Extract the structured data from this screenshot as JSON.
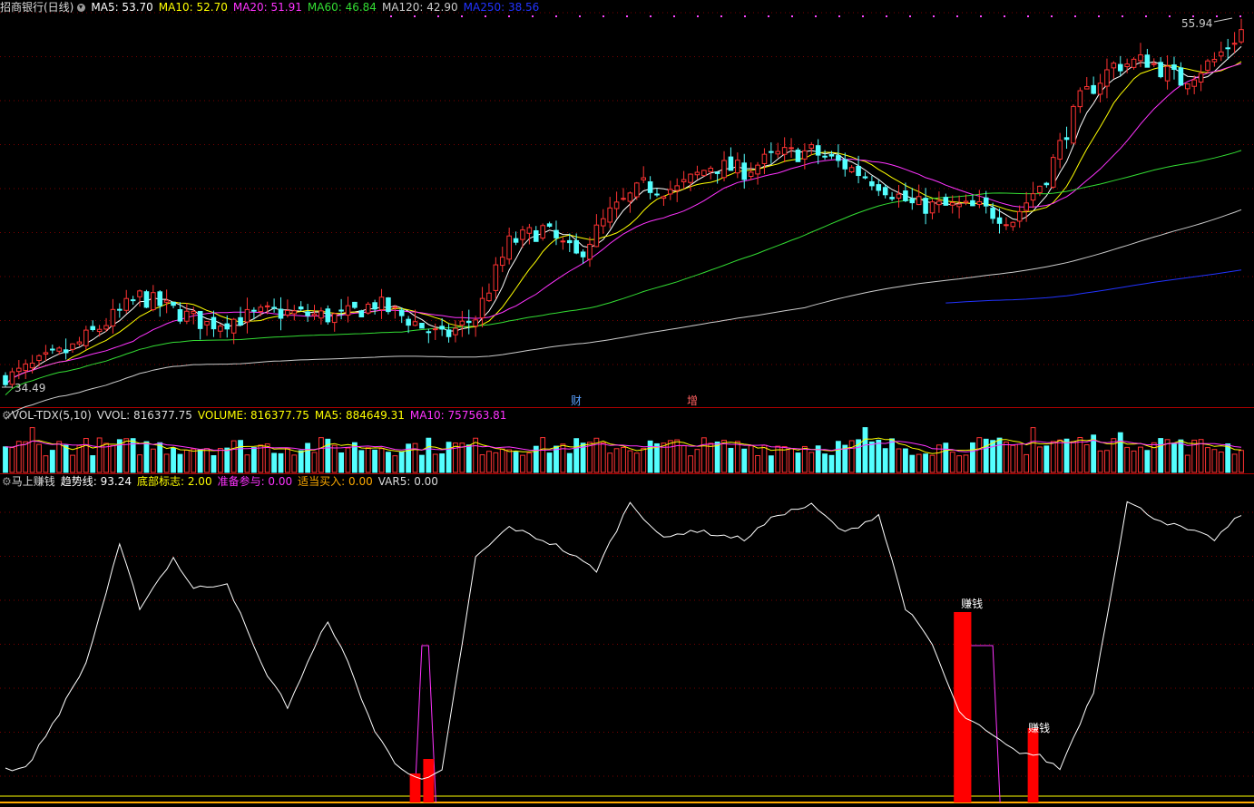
{
  "main_legend": {
    "title": "招商银行(日线)",
    "ma5": {
      "label": "MA5: 53.70",
      "color": "#ffffff"
    },
    "ma10": {
      "label": "MA10: 52.70",
      "color": "#ffff00"
    },
    "ma20": {
      "label": "MA20: 51.91",
      "color": "#ff33ff"
    },
    "ma60": {
      "label": "MA60: 46.84",
      "color": "#33dd33"
    },
    "ma120": {
      "label": "MA120: 42.90",
      "color": "#cccccc"
    },
    "ma250": {
      "label": "MA250: 38.56",
      "color": "#2233ff"
    }
  },
  "vol_legend": {
    "name": "VOL-TDX(5,10)",
    "vvol": "VVOL: 816377.75",
    "volume": "VOLUME: 816377.75",
    "ma5": "MA5: 884649.31",
    "ma10": "MA10: 757563.81"
  },
  "ind_legend": {
    "name": "马上赚钱",
    "trend": "趋势线: 93.24",
    "bottom": "底部标志: 2.00",
    "prepare": "准备参与: 0.00",
    "buy": "适当买入: 0.00",
    "var5": "VAR5: 0.00"
  },
  "annotations": {
    "high_label": "55.94",
    "low_label": "34.49",
    "cai": "财",
    "zeng": "增",
    "signal1": "赚钱",
    "signal2": "赚钱"
  },
  "colors": {
    "up": "#ff3333",
    "down": "#54ffff",
    "grid": "#7a0000",
    "divider": "#aa0000",
    "trend_line": "#ffffff",
    "prepare_line": "#ff33ff",
    "signal_bar": "#ff0000",
    "baseline": "#ffaa00"
  },
  "chart_data": [
    {
      "type": "candlestick",
      "title": "招商银行(日线)",
      "ylim": [
        34.49,
        55.94
      ],
      "key_prices": {
        "high": 55.94,
        "low": 34.49,
        "last_close_approx": 53.7
      },
      "trend_path": [
        [
          0,
          35.0
        ],
        [
          10,
          36.8
        ],
        [
          20,
          39.8
        ],
        [
          30,
          38.2
        ],
        [
          40,
          38.9
        ],
        [
          50,
          38.6
        ],
        [
          55,
          39.4
        ],
        [
          60,
          38.5
        ],
        [
          65,
          37.4
        ],
        [
          70,
          38.6
        ],
        [
          75,
          42.9
        ],
        [
          80,
          43.7
        ],
        [
          85,
          42.1
        ],
        [
          90,
          44.6
        ],
        [
          95,
          46.2
        ],
        [
          100,
          46.0
        ],
        [
          105,
          47.4
        ],
        [
          110,
          47.1
        ],
        [
          115,
          48.0
        ],
        [
          120,
          48.2
        ],
        [
          125,
          47.4
        ],
        [
          130,
          46.4
        ],
        [
          135,
          45.1
        ],
        [
          140,
          45.0
        ],
        [
          145,
          44.9
        ],
        [
          150,
          44.3
        ],
        [
          155,
          46.8
        ],
        [
          160,
          51.2
        ],
        [
          165,
          53.2
        ],
        [
          170,
          53.5
        ],
        [
          175,
          52.3
        ],
        [
          180,
          53.5
        ],
        [
          184,
          55.2
        ]
      ],
      "series_lines": [
        "MA5",
        "MA10",
        "MA20",
        "MA60",
        "MA120",
        "MA250"
      ]
    },
    {
      "type": "bar",
      "title": "VOL-TDX(5,10)",
      "last_volume": 816377.75,
      "ma5": 884649.31,
      "ma10": 757563.81
    },
    {
      "type": "line",
      "title": "马上赚钱",
      "trend_last": 93.24,
      "trend_path": [
        [
          0,
          10
        ],
        [
          3,
          10
        ],
        [
          8,
          28
        ],
        [
          12,
          44
        ],
        [
          17,
          82
        ],
        [
          20,
          62
        ],
        [
          25,
          78
        ],
        [
          28,
          68
        ],
        [
          33,
          70
        ],
        [
          38,
          44
        ],
        [
          42,
          30
        ],
        [
          48,
          58
        ],
        [
          51,
          44
        ],
        [
          55,
          22
        ],
        [
          58,
          12
        ],
        [
          62,
          6
        ],
        [
          65,
          9
        ],
        [
          70,
          78
        ],
        [
          75,
          88
        ],
        [
          82,
          82
        ],
        [
          88,
          74
        ],
        [
          93,
          96
        ],
        [
          98,
          84
        ],
        [
          102,
          87
        ],
        [
          110,
          84
        ],
        [
          115,
          92
        ],
        [
          120,
          95
        ],
        [
          125,
          86
        ],
        [
          130,
          92
        ],
        [
          134,
          62
        ],
        [
          138,
          50
        ],
        [
          142,
          28
        ],
        [
          146,
          22
        ],
        [
          150,
          16
        ],
        [
          154,
          14
        ],
        [
          157,
          10
        ],
        [
          162,
          35
        ],
        [
          167,
          96
        ],
        [
          172,
          90
        ],
        [
          180,
          84
        ],
        [
          184,
          92
        ]
      ],
      "bottom_signal_days": [
        62,
        63,
        143,
        144,
        153
      ],
      "labels": [
        "赚钱",
        "赚钱"
      ]
    }
  ]
}
